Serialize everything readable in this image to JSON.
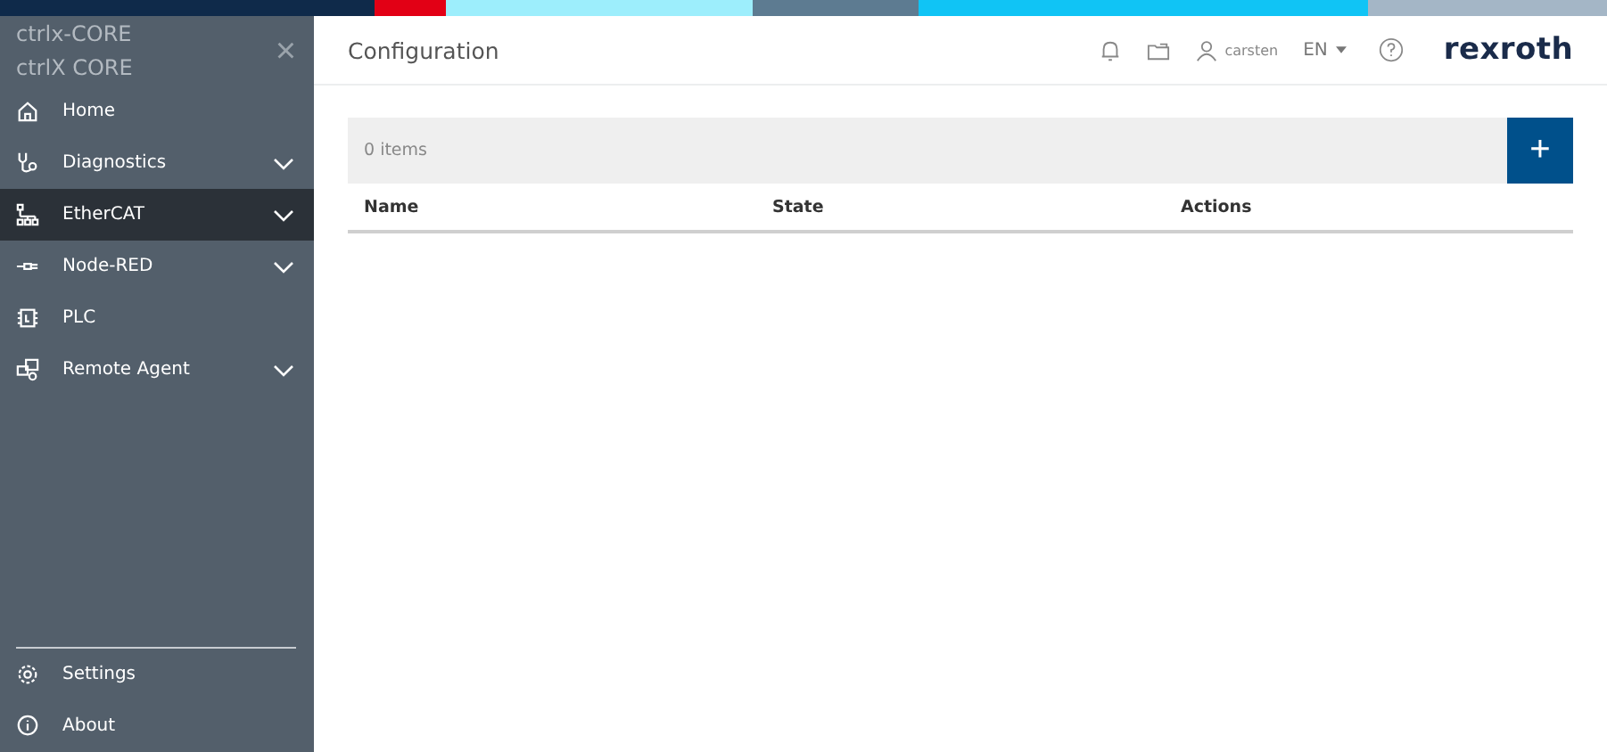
{
  "sidebar": {
    "device_name": "ctrlx-CORE",
    "device_type": "ctrlX CORE",
    "close_icon": "×",
    "items": [
      {
        "label": "Home",
        "kind": "home",
        "selected": false,
        "expandable": false
      },
      {
        "label": "Diagnostics",
        "kind": "diagnostics",
        "selected": false,
        "expandable": true
      },
      {
        "label": "EtherCAT",
        "kind": "network",
        "selected": true,
        "expandable": true
      },
      {
        "label": "Node-RED",
        "kind": "plug",
        "selected": false,
        "expandable": true
      },
      {
        "label": "PLC",
        "kind": "chip",
        "selected": false,
        "expandable": false
      },
      {
        "label": "Remote Agent",
        "kind": "remote",
        "selected": false,
        "expandable": true
      }
    ],
    "bottom_items": [
      {
        "label": "Settings",
        "kind": "settings"
      },
      {
        "label": "About",
        "kind": "info"
      }
    ]
  },
  "header": {
    "title": "Configuration",
    "user": "carsten",
    "language": "EN",
    "logo": "rexroth"
  },
  "table": {
    "count": "0 items",
    "add_button": "+",
    "columns": [
      "Name",
      "State",
      "Actions"
    ]
  }
}
